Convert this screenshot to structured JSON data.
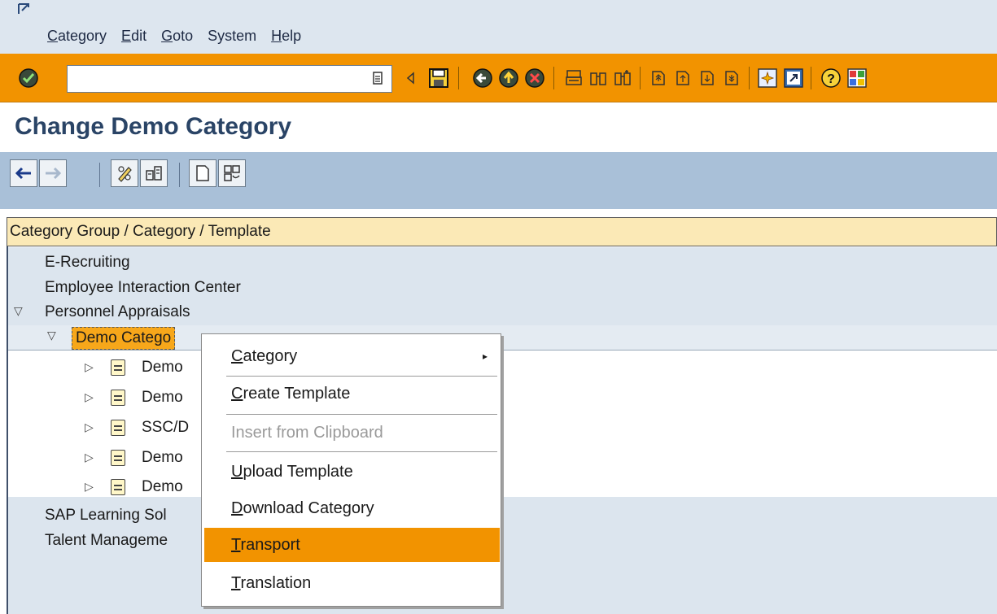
{
  "menubar": {
    "items": [
      {
        "accel": "C",
        "rest": "ategory"
      },
      {
        "accel": "E",
        "rest": "dit"
      },
      {
        "accel": "G",
        "rest": "oto"
      },
      {
        "accel": "",
        "rest": "System"
      },
      {
        "accel": "H",
        "rest": "elp"
      }
    ]
  },
  "toolbar": {
    "command_field_value": ""
  },
  "page": {
    "title": "Change Demo Category"
  },
  "tree": {
    "header": "Category Group / Category / Template",
    "rows": [
      {
        "label": "E-Recruiting"
      },
      {
        "label": "Employee Interaction Center"
      },
      {
        "label": "Personnel Appraisals"
      },
      {
        "label": "Demo Catego"
      },
      {
        "label": "Demo"
      },
      {
        "label": "Demo"
      },
      {
        "label": "SSC/D"
      },
      {
        "label": "Demo"
      },
      {
        "label": "Demo"
      },
      {
        "label": "SAP Learning Sol"
      },
      {
        "label": "Talent Manageme"
      }
    ]
  },
  "context_menu": {
    "items": [
      {
        "accel": "C",
        "rest": "ategory",
        "state": "normal",
        "submenu": true
      },
      {
        "accel": "C",
        "rest": "reate Template",
        "state": "normal"
      },
      {
        "accel": "",
        "rest": "Insert from Clipboard",
        "state": "disabled"
      },
      {
        "accel": "U",
        "rest": "pload Template",
        "state": "normal"
      },
      {
        "accel": "D",
        "rest": "ownload Category",
        "state": "normal"
      },
      {
        "accel": "T",
        "rest": "ransport",
        "state": "highlighted"
      },
      {
        "accel": "T",
        "rest": "ranslation",
        "state": "normal"
      }
    ],
    "submenu_arrow": "▸"
  }
}
